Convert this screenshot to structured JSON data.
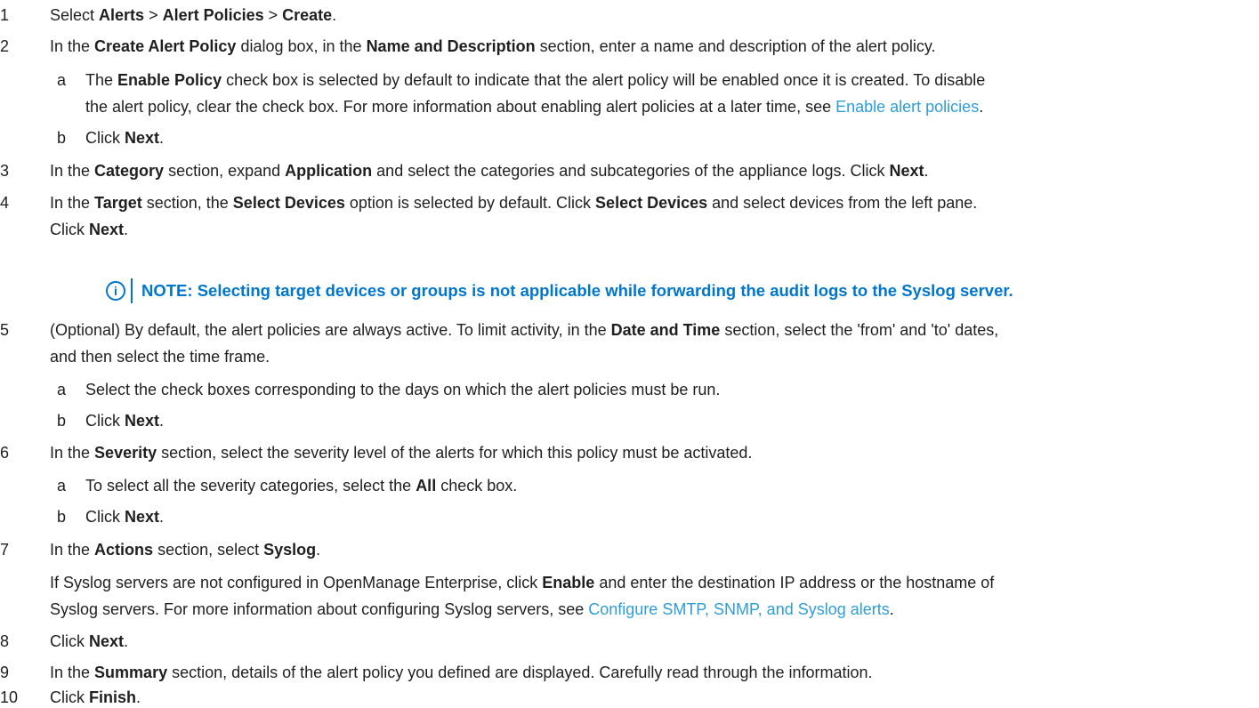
{
  "steps": {
    "s1": {
      "num": "1",
      "t1": "Select ",
      "b1": "Alerts",
      "t2": " > ",
      "b2": "Alert Policies",
      "t3": " > ",
      "b3": "Create",
      "t4": "."
    },
    "s2": {
      "num": "2",
      "t1": "In the ",
      "b1": "Create Alert Policy",
      "t2": " dialog box, in the ",
      "b2": "Name and Description",
      "t3": " section, enter a name and description of the alert policy."
    },
    "s2a": {
      "num": "a",
      "t1": "The ",
      "b1": "Enable Policy",
      "t2": " check box is selected by default to indicate that the alert policy will be enabled once it is created. To disable",
      "line2": "the alert policy, clear the check box. For more information about enabling alert policies at a later time, see ",
      "link": "Enable alert policies",
      "t3": "."
    },
    "s2b": {
      "num": "b",
      "t1": "Click ",
      "b1": "Next",
      "t2": "."
    },
    "s3": {
      "num": "3",
      "t1": "In the ",
      "b1": "Category",
      "t2": " section, expand ",
      "b2": "Application",
      "t3": " and select the categories and subcategories of the appliance logs. Click ",
      "b3": "Next",
      "t4": "."
    },
    "s4": {
      "num": "4",
      "t1": "In the ",
      "b1": "Target",
      "t2": " section, the ",
      "b2": "Select Devices",
      "t3": " option is selected by default. Click ",
      "b3": "Select Devices",
      "t4": " and select devices from the left pane.",
      "line2a": "Click ",
      "b4": "Next",
      "t5": "."
    },
    "note": {
      "icon": "i",
      "label": "NOTE:",
      "text": " Selecting target devices or groups is not applicable while forwarding the audit logs to the Syslog server."
    },
    "s5": {
      "num": "5",
      "t1": "(Optional) By default, the alert policies are always active. To limit activity, in the ",
      "b1": "Date and Time",
      "t2": " section, select the 'from' and 'to' dates,",
      "line2": "and then select the time frame."
    },
    "s5a": {
      "num": "a",
      "t1": "Select the check boxes corresponding to the days on which the alert policies must be run."
    },
    "s5b": {
      "num": "b",
      "t1": "Click ",
      "b1": "Next",
      "t2": "."
    },
    "s6": {
      "num": "6",
      "t1": "In the ",
      "b1": "Severity",
      "t2": " section, select the severity level of the alerts for which this policy must be activated."
    },
    "s6a": {
      "num": "a",
      "t1": "To select all the severity categories, select the ",
      "b1": "All",
      "t2": " check box."
    },
    "s6b": {
      "num": "b",
      "t1": "Click ",
      "b1": "Next",
      "t2": "."
    },
    "s7": {
      "num": "7",
      "t1": "In the ",
      "b1": "Actions",
      "t2": " section, select ",
      "b2": "Syslog",
      "t3": "."
    },
    "s7p": {
      "t1": "If Syslog servers are not configured in OpenManage Enterprise, click ",
      "b1": "Enable",
      "t2": " and enter the destination IP address or the hostname of",
      "line2": "Syslog servers. For more information about configuring Syslog servers, see ",
      "link": "Configure SMTP, SNMP, and Syslog alerts",
      "t3": "."
    },
    "s8": {
      "num": "8",
      "t1": "Click ",
      "b1": "Next",
      "t2": "."
    },
    "s9": {
      "num": "9",
      "t1": "In the ",
      "b1": "Summary",
      "t2": " section, details of the alert policy you defined are displayed. Carefully read through the information."
    },
    "s10": {
      "num": "10",
      "t1": "Click ",
      "b1": "Finish",
      "t2": "."
    }
  },
  "colors": {
    "link": "#2e9dd8",
    "note": "#0076ce",
    "text": "#1f1f1f"
  }
}
